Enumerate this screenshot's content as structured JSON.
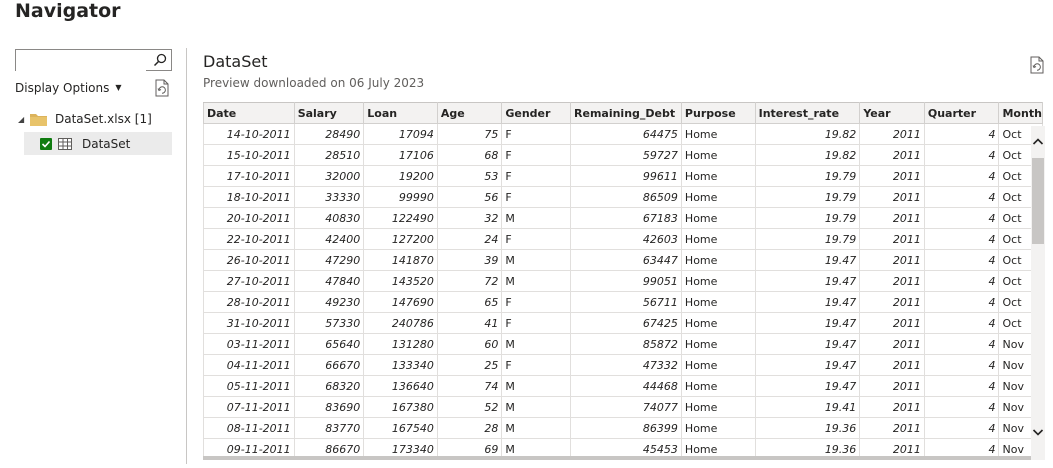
{
  "window": {
    "title": "Navigator"
  },
  "left_pane": {
    "search": {
      "value": "",
      "placeholder": ""
    },
    "display_options_label": "Display Options",
    "tree": {
      "file_label": "DataSet.xlsx [1]",
      "item_label": "DataSet",
      "item_checked": true
    }
  },
  "preview": {
    "title": "DataSet",
    "subtitle": "Preview downloaded on 06 July 2023",
    "columns": [
      "Date",
      "Salary",
      "Loan",
      "Age",
      "Gender",
      "Remaining_Debt",
      "Purpose",
      "Interest_rate",
      "Year",
      "Quarter",
      "Month"
    ],
    "rows": [
      [
        "14-10-2011",
        "28490",
        "17094",
        "75",
        "F",
        "64475",
        "Home",
        "19.82",
        "2011",
        "4",
        "Oct"
      ],
      [
        "15-10-2011",
        "28510",
        "17106",
        "68",
        "F",
        "59727",
        "Home",
        "19.82",
        "2011",
        "4",
        "Oct"
      ],
      [
        "17-10-2011",
        "32000",
        "19200",
        "53",
        "F",
        "99611",
        "Home",
        "19.79",
        "2011",
        "4",
        "Oct"
      ],
      [
        "18-10-2011",
        "33330",
        "99990",
        "56",
        "F",
        "86509",
        "Home",
        "19.79",
        "2011",
        "4",
        "Oct"
      ],
      [
        "20-10-2011",
        "40830",
        "122490",
        "32",
        "M",
        "67183",
        "Home",
        "19.79",
        "2011",
        "4",
        "Oct"
      ],
      [
        "22-10-2011",
        "42400",
        "127200",
        "24",
        "F",
        "42603",
        "Home",
        "19.79",
        "2011",
        "4",
        "Oct"
      ],
      [
        "26-10-2011",
        "47290",
        "141870",
        "39",
        "M",
        "63447",
        "Home",
        "19.47",
        "2011",
        "4",
        "Oct"
      ],
      [
        "27-10-2011",
        "47840",
        "143520",
        "72",
        "M",
        "99051",
        "Home",
        "19.47",
        "2011",
        "4",
        "Oct"
      ],
      [
        "28-10-2011",
        "49230",
        "147690",
        "65",
        "F",
        "56711",
        "Home",
        "19.47",
        "2011",
        "4",
        "Oct"
      ],
      [
        "31-10-2011",
        "57330",
        "240786",
        "41",
        "F",
        "67425",
        "Home",
        "19.47",
        "2011",
        "4",
        "Oct"
      ],
      [
        "03-11-2011",
        "65640",
        "131280",
        "60",
        "M",
        "85872",
        "Home",
        "19.47",
        "2011",
        "4",
        "Nov"
      ],
      [
        "04-11-2011",
        "66670",
        "133340",
        "25",
        "F",
        "47332",
        "Home",
        "19.47",
        "2011",
        "4",
        "Nov"
      ],
      [
        "05-11-2011",
        "68320",
        "136640",
        "74",
        "M",
        "44468",
        "Home",
        "19.47",
        "2011",
        "4",
        "Nov"
      ],
      [
        "07-11-2011",
        "83690",
        "167380",
        "52",
        "M",
        "74077",
        "Home",
        "19.41",
        "2011",
        "4",
        "Nov"
      ],
      [
        "08-11-2011",
        "83770",
        "167540",
        "28",
        "M",
        "86399",
        "Home",
        "19.36",
        "2011",
        "4",
        "Nov"
      ],
      [
        "09-11-2011",
        "86670",
        "173340",
        "69",
        "M",
        "45453",
        "Home",
        "19.36",
        "2011",
        "4",
        "Nov"
      ]
    ]
  },
  "colors": {
    "checkbox": "#107c10",
    "folder": "#dcb35c",
    "header_bg": "#f3f2f1",
    "selected_item_bg": "#ebebeb"
  },
  "icons": {
    "search": "search-icon",
    "refresh": "refresh-icon",
    "folder": "folder-icon",
    "table": "table-icon"
  }
}
